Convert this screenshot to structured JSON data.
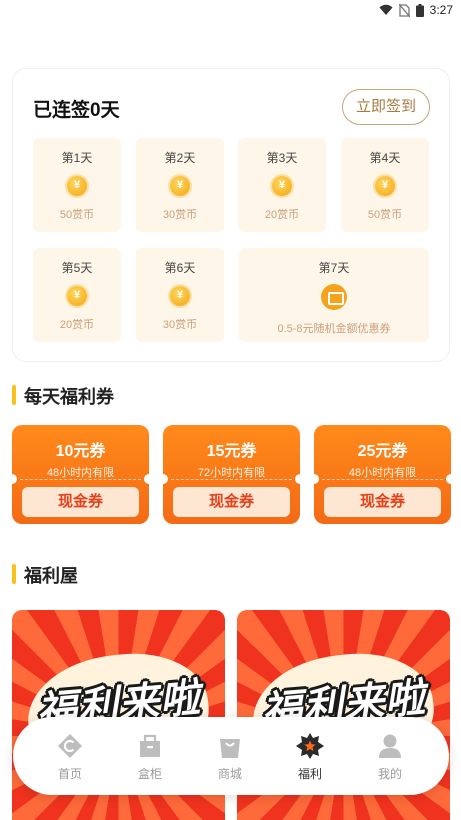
{
  "status_bar": {
    "time": "3:27"
  },
  "signin": {
    "title": "已连签0天",
    "button": "立即签到",
    "days": [
      {
        "label": "第1天",
        "reward": "50赏币"
      },
      {
        "label": "第2天",
        "reward": "30赏币"
      },
      {
        "label": "第3天",
        "reward": "20赏币"
      },
      {
        "label": "第4天",
        "reward": "50赏币"
      },
      {
        "label": "第5天",
        "reward": "20赏币"
      },
      {
        "label": "第6天",
        "reward": "30赏币"
      },
      {
        "label": "第7天",
        "reward": "0.5-8元随机金额优惠券"
      }
    ]
  },
  "daily_coupons": {
    "title": "每天福利券",
    "items": [
      {
        "amount": "10元券",
        "validity": "48小时内有限",
        "button": "现金券"
      },
      {
        "amount": "15元券",
        "validity": "72小时内有限",
        "button": "现金券"
      },
      {
        "amount": "25元券",
        "validity": "48小时内有限",
        "button": "现金券"
      }
    ]
  },
  "welfare_house": {
    "title": "福利屋",
    "posters": [
      {
        "text": "福利来啦"
      },
      {
        "text": "福利来啦"
      }
    ]
  },
  "bottom_nav": {
    "active": "福利",
    "items": [
      {
        "label": "首页",
        "icon": "home-icon"
      },
      {
        "label": "盒柜",
        "icon": "box-cabinet-icon"
      },
      {
        "label": "商城",
        "icon": "shopping-bag-icon"
      },
      {
        "label": "福利",
        "icon": "welfare-star-icon"
      },
      {
        "label": "我的",
        "icon": "person-icon"
      }
    ]
  },
  "colors": {
    "accent_orange": "#f46a16",
    "gold": "#c8a572",
    "section_bar": "#f8c21b",
    "poster_red": "#f0331e"
  }
}
